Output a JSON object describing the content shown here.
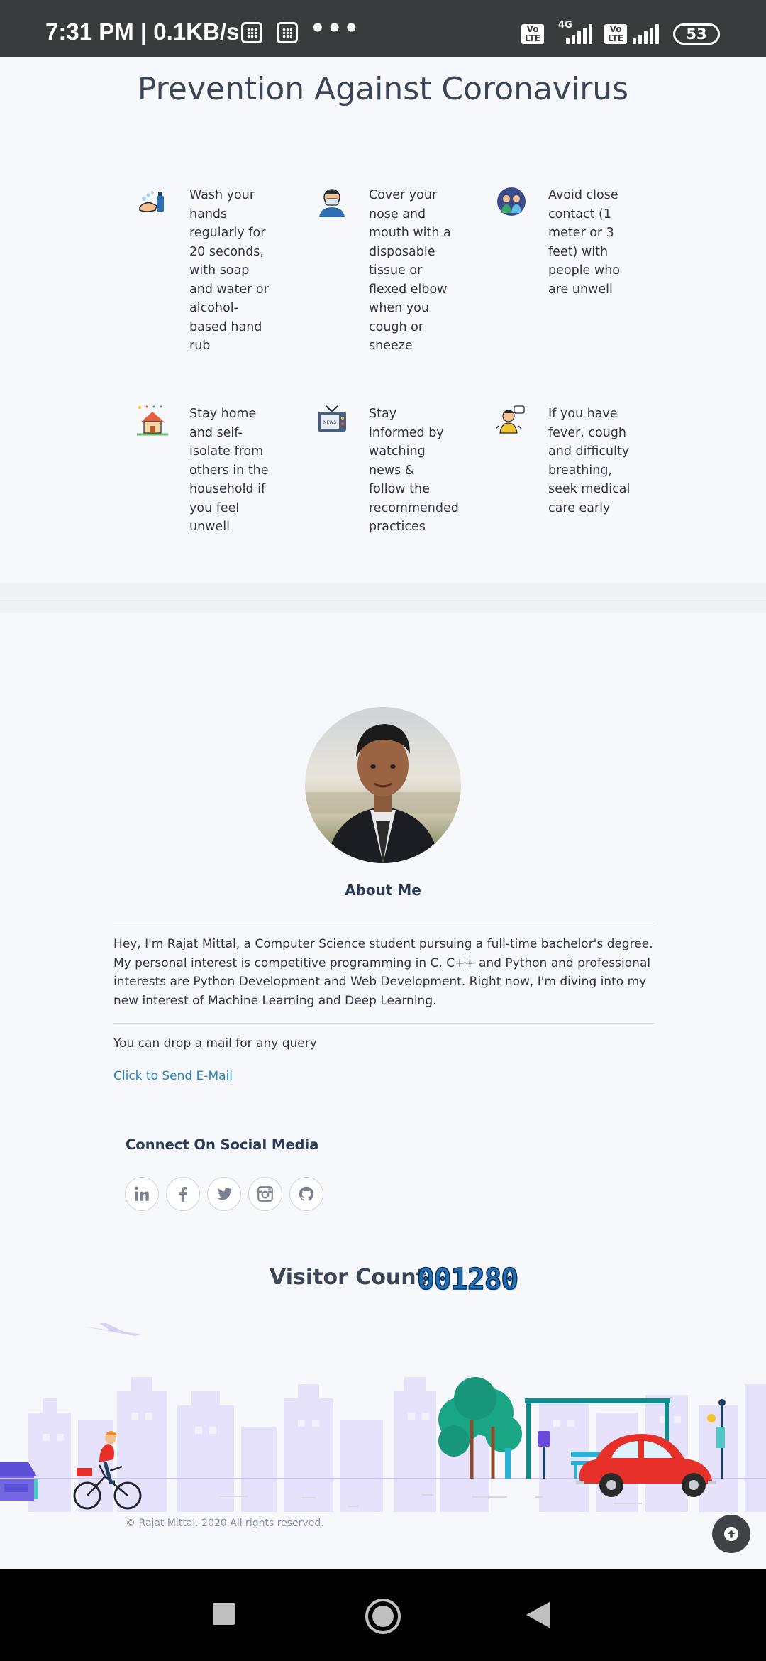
{
  "status_bar": {
    "time_speed": "7:31 PM | 0.1KB/s",
    "dots": "•••",
    "volte1": "Vo LTE",
    "network": "4G",
    "volte2": "Vo LTE",
    "battery": "53"
  },
  "prevention": {
    "title": "Prevention Against Coronavirus",
    "tips": [
      {
        "icon": "hand-wash-icon",
        "text": "Wash your hands regularly for 20 seconds, with soap and water or alcohol-based hand rub"
      },
      {
        "icon": "face-mask-icon",
        "text": "Cover your nose and mouth with a disposable tissue or flexed elbow when you cough or sneeze"
      },
      {
        "icon": "social-distance-icon",
        "text": "Avoid close contact (1 meter or 3 feet) with people who are unwell"
      },
      {
        "icon": "stay-home-icon",
        "text": "Stay home and self-isolate from others in the household if you feel unwell"
      },
      {
        "icon": "news-tv-icon",
        "text": "Stay informed by watching news & follow the recommended practices"
      },
      {
        "icon": "doctor-consult-icon",
        "text": "If you have fever, cough and difficulty breathing, seek medical care early"
      }
    ],
    "tv_label": "NEWS"
  },
  "about": {
    "title": "About Me",
    "text": "Hey, I'm Rajat Mittal, a Computer Science student pursuing a full-time bachelor's degree. My personal interest is competitive programming in C, C++ and Python and professional interests are Python Development and Web Development. Right now, I'm diving into my new interest of Machine Learning and Deep Learning.",
    "mail_prompt": "You can drop a mail for any query",
    "mail_link": "Click to Send E-Mail"
  },
  "social": {
    "title": "Connect On Social Media",
    "items": [
      "linkedin-icon",
      "facebook-icon",
      "twitter-icon",
      "instagram-icon",
      "github-icon"
    ]
  },
  "visitor": {
    "label": "Visitor Count:",
    "count": "001280"
  },
  "footer": {
    "copyright": "© Rajat Mittal. 2020 All rights reserved."
  },
  "colors": {
    "accent_link": "#2a86c0",
    "heading": "#2b3a55",
    "city": "#e6e2fb",
    "car": "#e8302a",
    "tree": "#1aa584"
  }
}
